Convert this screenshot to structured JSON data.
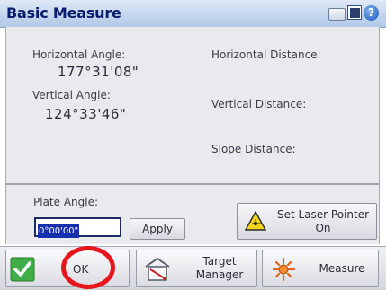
{
  "window": {
    "title": "Basic Measure",
    "icons": [
      "keyboard-icon",
      "grid-icon",
      "help-icon"
    ],
    "help_glyph": "?"
  },
  "angles": {
    "horizontal_label": "Horizontal Angle:",
    "horizontal_value": "177°31'08\"",
    "vertical_label": "Vertical Angle:",
    "vertical_value": "124°33'46\""
  },
  "distances": {
    "horizontal_label": "Horizontal Distance:",
    "vertical_label": "Vertical Distance:",
    "slope_label": "Slope Distance:"
  },
  "plate": {
    "label": "Plate Angle:",
    "value": "0°00'00\"",
    "apply_label": "Apply"
  },
  "laser": {
    "label_line1": "Set Laser Pointer",
    "label_line2": "On"
  },
  "bottom_bar": {
    "ok_label": "OK",
    "target_line1": "Target",
    "target_line2": "Manager",
    "measure_label": "Measure"
  },
  "colors": {
    "title_text": "#0a1c6e",
    "highlight_ring": "#e8151d",
    "input_selection": "#1531b0"
  }
}
